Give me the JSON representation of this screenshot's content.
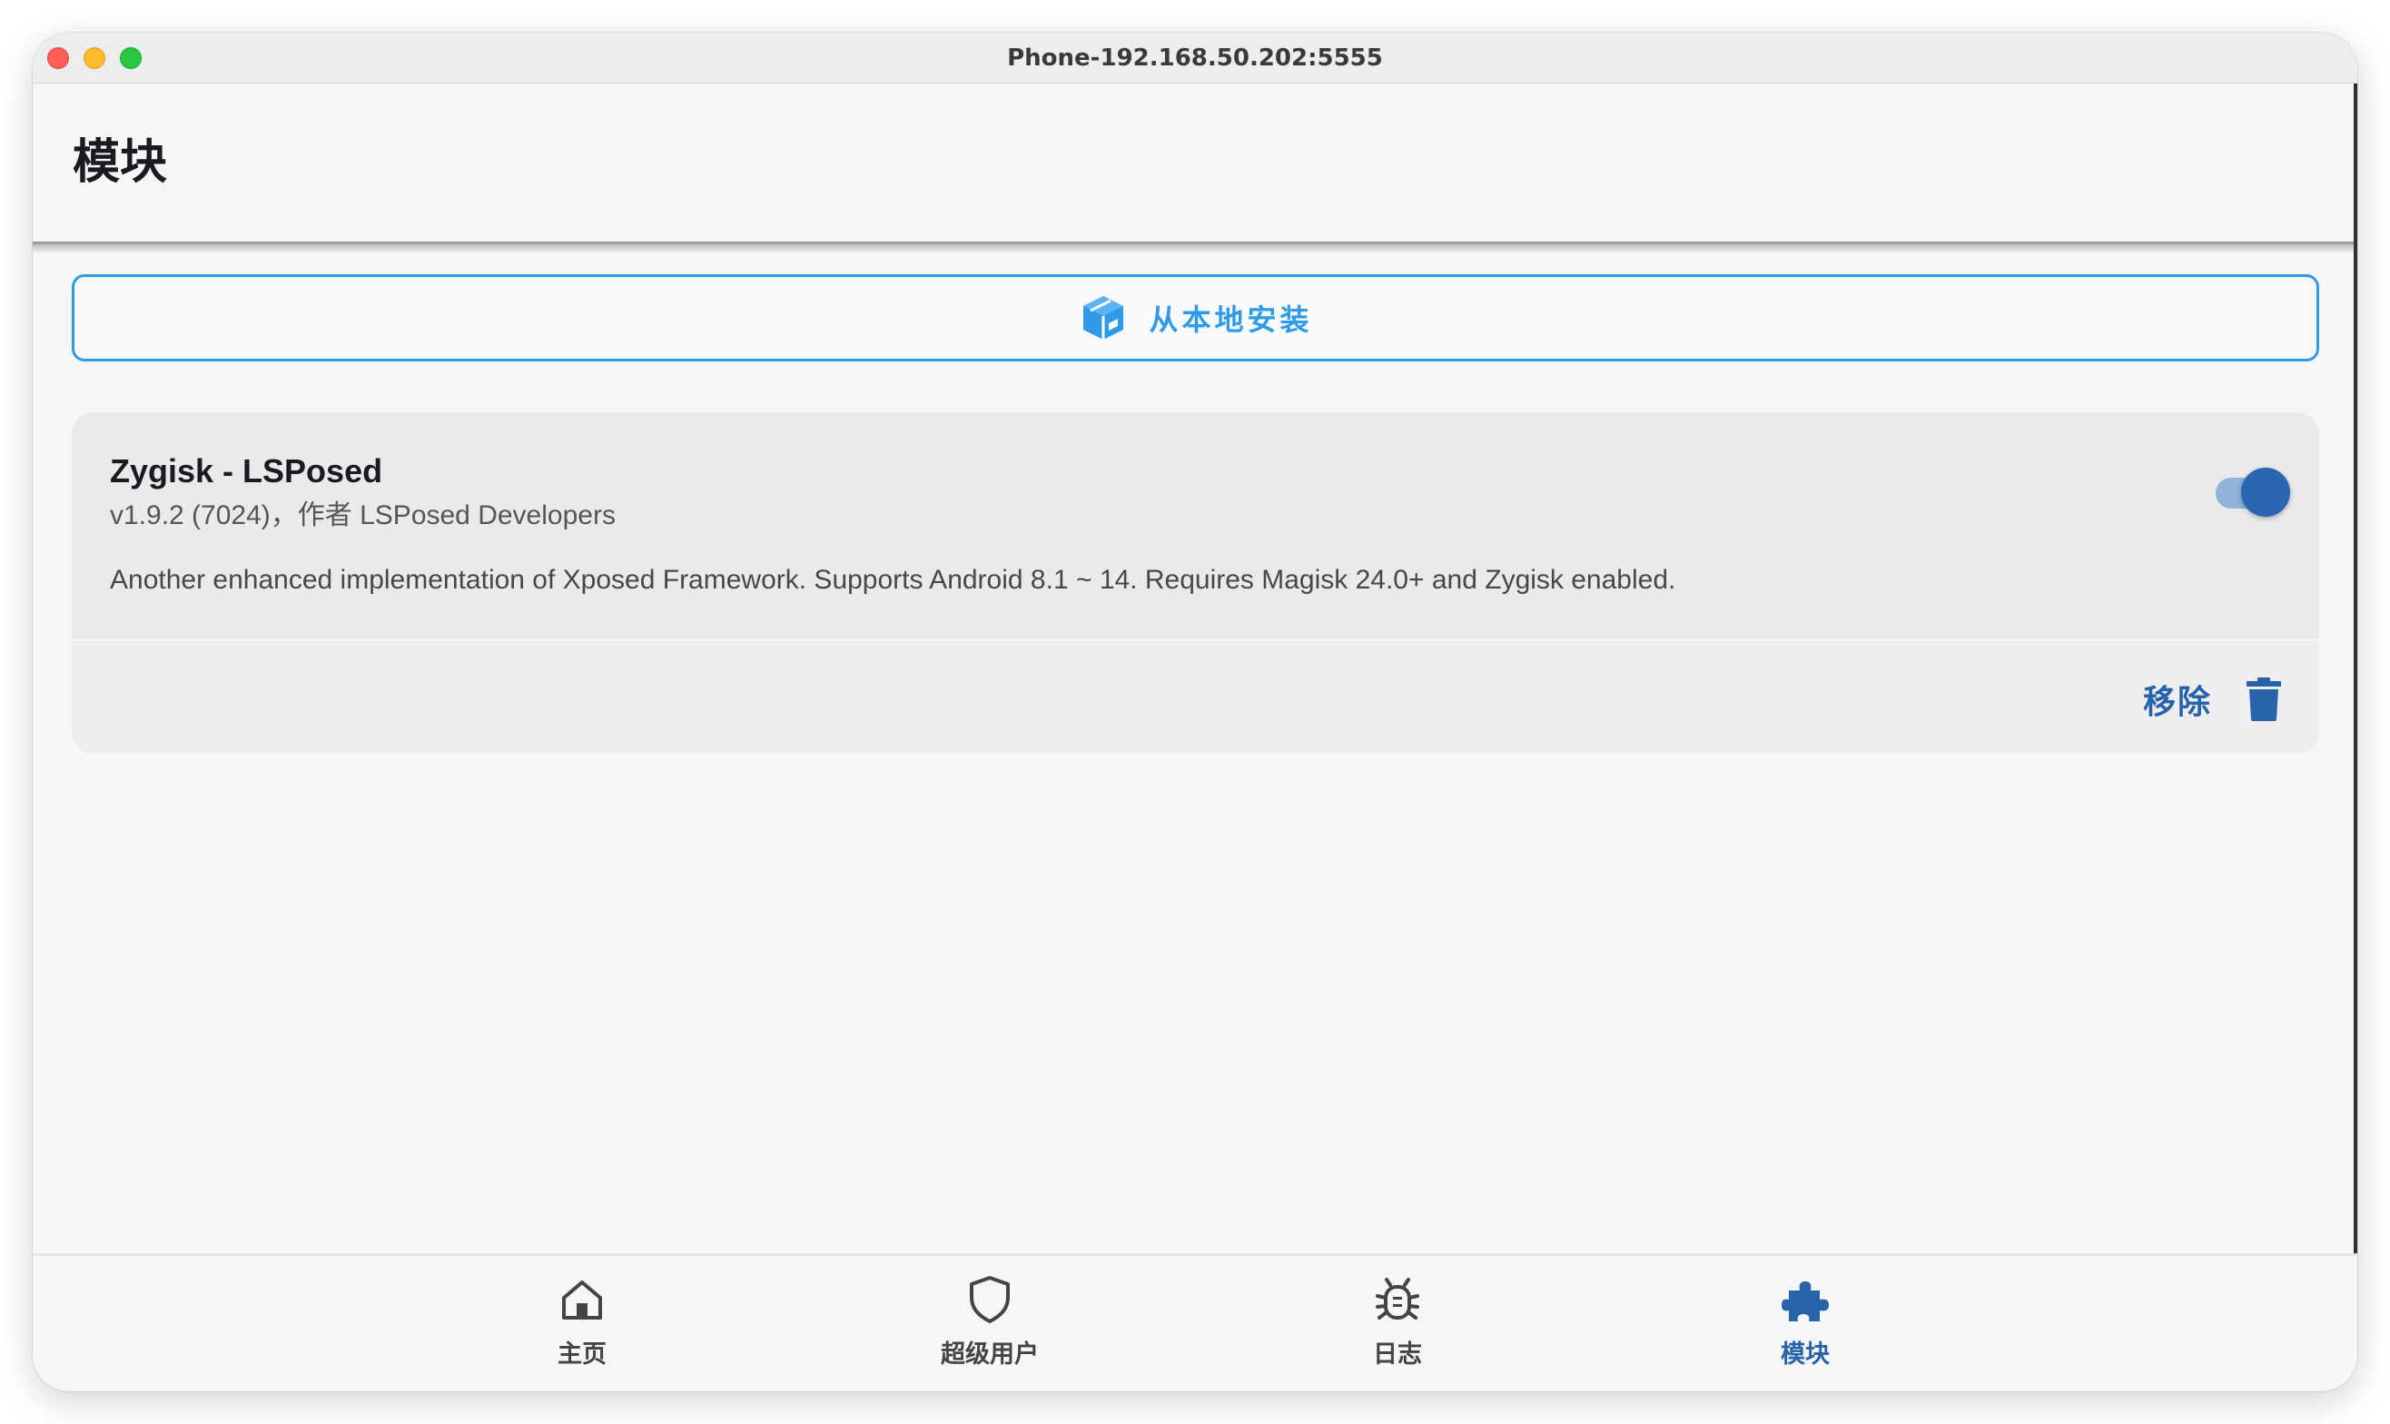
{
  "window": {
    "title": "Phone-192.168.50.202:5555"
  },
  "appbar": {
    "title": "模块"
  },
  "install": {
    "label": "从本地安装",
    "accent": "#2f9be6"
  },
  "module": {
    "name": "Zygisk - LSPosed",
    "meta": "v1.9.2 (7024)，作者 LSPosed Developers",
    "description": "Another enhanced implementation of Xposed Framework. Supports Android 8.1 ~ 14. Requires Magisk 24.0+ and Zygisk enabled.",
    "enabled": true,
    "remove_label": "移除",
    "accent": "#2763a8"
  },
  "nav": {
    "items": [
      {
        "label": "主页",
        "icon": "home-icon",
        "active": false
      },
      {
        "label": "超级用户",
        "icon": "shield-icon",
        "active": false
      },
      {
        "label": "日志",
        "icon": "bug-icon",
        "active": false
      },
      {
        "label": "模块",
        "icon": "puzzle-icon",
        "active": true
      }
    ]
  }
}
